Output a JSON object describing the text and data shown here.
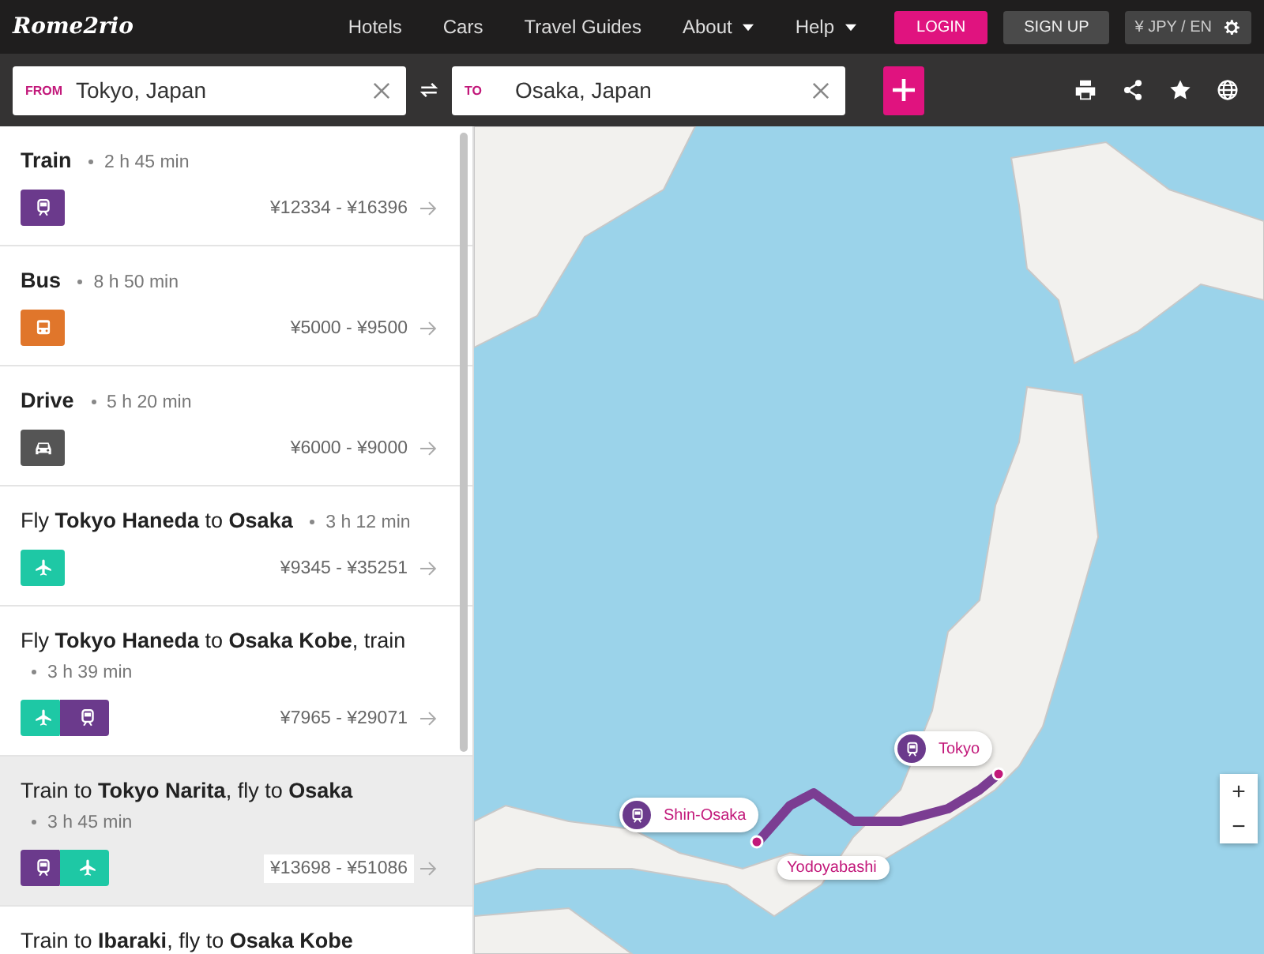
{
  "header": {
    "logo": "Rome2rio",
    "nav": [
      {
        "label": "Hotels",
        "has_menu": false
      },
      {
        "label": "Cars",
        "has_menu": false
      },
      {
        "label": "Travel Guides",
        "has_menu": false
      },
      {
        "label": "About",
        "has_menu": true
      },
      {
        "label": "Help",
        "has_menu": true
      }
    ],
    "login": "LOGIN",
    "signup": "SIGN UP",
    "currency": "¥ JPY / EN"
  },
  "search": {
    "from_label": "FROM",
    "from_value": "Tokyo, Japan",
    "to_label": "TO",
    "to_value": "Osaka, Japan"
  },
  "routes": [
    {
      "title": "**Train**",
      "duration": "2 h 45 min",
      "modes": [
        {
          "kind": "train"
        }
      ],
      "price": "¥12334 - ¥16396",
      "selected": false
    },
    {
      "title": "**Bus**",
      "duration": "8 h 50 min",
      "modes": [
        {
          "kind": "bus"
        }
      ],
      "price": "¥5000 - ¥9500",
      "selected": false
    },
    {
      "title": "**Drive**",
      "duration": "5 h 20 min",
      "modes": [
        {
          "kind": "car"
        }
      ],
      "price": "¥6000 - ¥9000",
      "selected": false
    },
    {
      "title": "Fly **Tokyo Haneda** to **Osaka**",
      "duration": "3 h 12 min",
      "modes": [
        {
          "kind": "plane"
        }
      ],
      "price": "¥9345 - ¥35251",
      "selected": false
    },
    {
      "title": "Fly **Tokyo Haneda** to **Osaka Kobe**, train",
      "duration": "3 h 39 min",
      "modes": [
        {
          "kind": "plane"
        },
        {
          "kind": "train"
        }
      ],
      "price": "¥7965 - ¥29071",
      "selected": false
    },
    {
      "title": "Train to **Tokyo Narita**, fly to **Osaka**",
      "duration": "3 h 45 min",
      "modes": [
        {
          "kind": "train"
        },
        {
          "kind": "plane"
        }
      ],
      "price": "¥13698 - ¥51086",
      "selected": true
    },
    {
      "title": "Train to **Ibaraki**, fly to **Osaka Kobe**",
      "selected": false
    }
  ],
  "map": {
    "pins": [
      {
        "label": "Tokyo",
        "kind": "station"
      },
      {
        "label": "Shin-Osaka",
        "kind": "station"
      },
      {
        "label": "Yodoyabashi",
        "kind": "stop"
      }
    ],
    "zoom_in": "+",
    "zoom_out": "−"
  }
}
